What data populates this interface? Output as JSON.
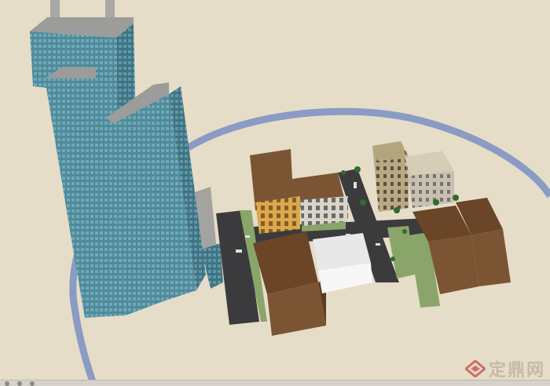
{
  "watermark": {
    "text": "定鼎网",
    "icon": "diamond-logo-icon"
  },
  "colors": {
    "ground": "#e6ddc8",
    "ring": "#8a9bc4",
    "road": "#3b3b3e",
    "tower_face": "#4f8a9a",
    "tower_side": "#3d6f7e",
    "tower_top": "#9c9c9a",
    "brown_block": "#7b5533",
    "white_block": "#f3f3f3",
    "grass": "#8aa56a"
  }
}
